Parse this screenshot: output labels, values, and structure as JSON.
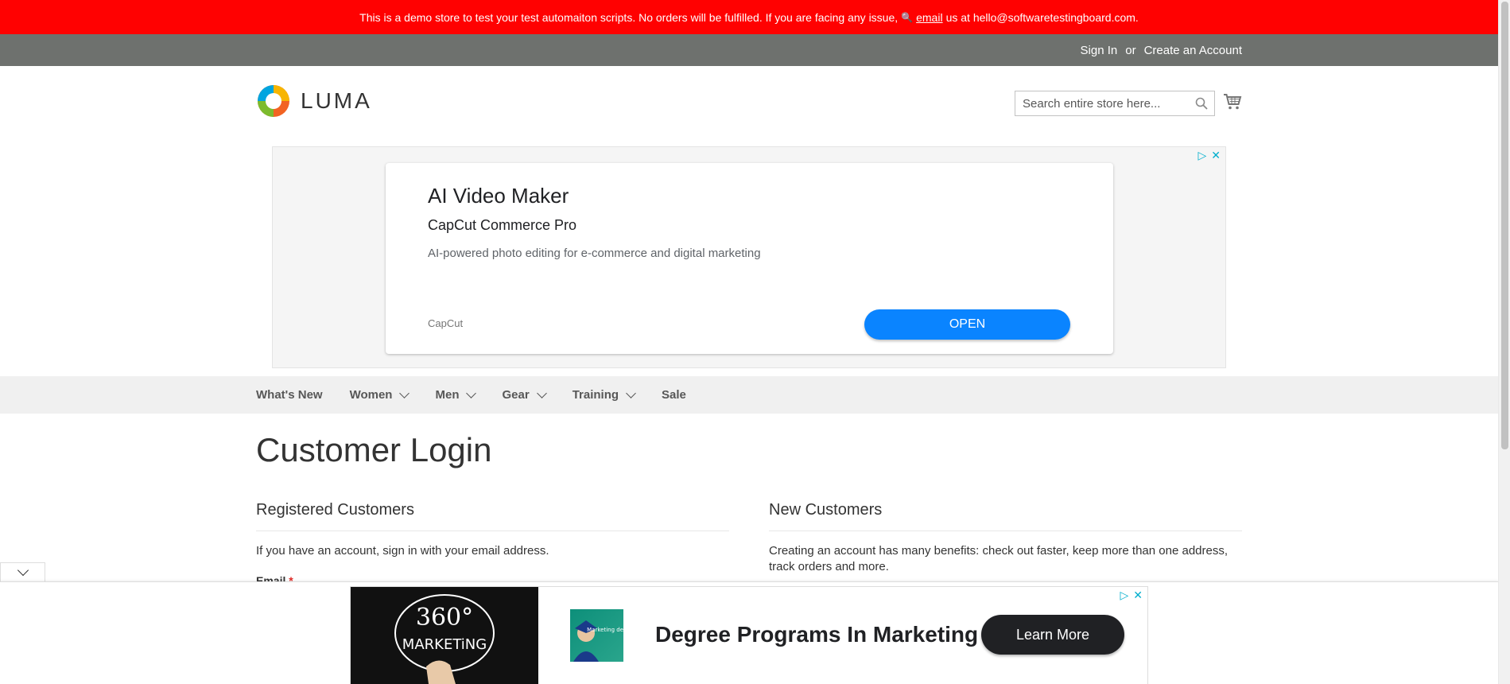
{
  "demo_notice": {
    "text_before": "This is a demo store to test your test automaiton scripts. No orders will be fulfilled. If you are facing any issue,",
    "email_link": "email",
    "text_after": "us at hello@softwaretestingboard.com."
  },
  "header_links": {
    "sign_in": "Sign In",
    "or": "or",
    "create_account": "Create an Account"
  },
  "logo": {
    "text": "LUMA"
  },
  "search": {
    "placeholder": "Search entire store here..."
  },
  "ad_top": {
    "title": "AI Video Maker",
    "subtitle": "CapCut Commerce Pro",
    "description": "AI-powered photo editing for e-commerce and digital marketing",
    "brand": "CapCut",
    "cta": "OPEN"
  },
  "nav": {
    "items": [
      {
        "label": "What's New",
        "has_menu": false
      },
      {
        "label": "Women",
        "has_menu": true
      },
      {
        "label": "Men",
        "has_menu": true
      },
      {
        "label": "Gear",
        "has_menu": true
      },
      {
        "label": "Training",
        "has_menu": true
      },
      {
        "label": "Sale",
        "has_menu": false
      }
    ]
  },
  "main": {
    "page_title": "Customer Login",
    "registered": {
      "title": "Registered Customers",
      "text": "If you have an account, sign in with your email address.",
      "email_label": "Email",
      "required_mark": "*"
    },
    "new_customers": {
      "title": "New Customers",
      "text": "Creating an account has many benefits: check out faster, keep more than one address, track orders and more."
    }
  },
  "ad_bottom": {
    "image_text_top": "360°",
    "image_text_bottom": "MARKETiNG",
    "thumb_text": "Marketing degree",
    "headline": "Degree Programs In Marketing",
    "cta": "Learn More"
  },
  "colors": {
    "demo_bar": "#ff0101",
    "header_panel": "#6e716e",
    "nav_bg": "#f0f0f0",
    "ad_open": "#0a84ff"
  }
}
